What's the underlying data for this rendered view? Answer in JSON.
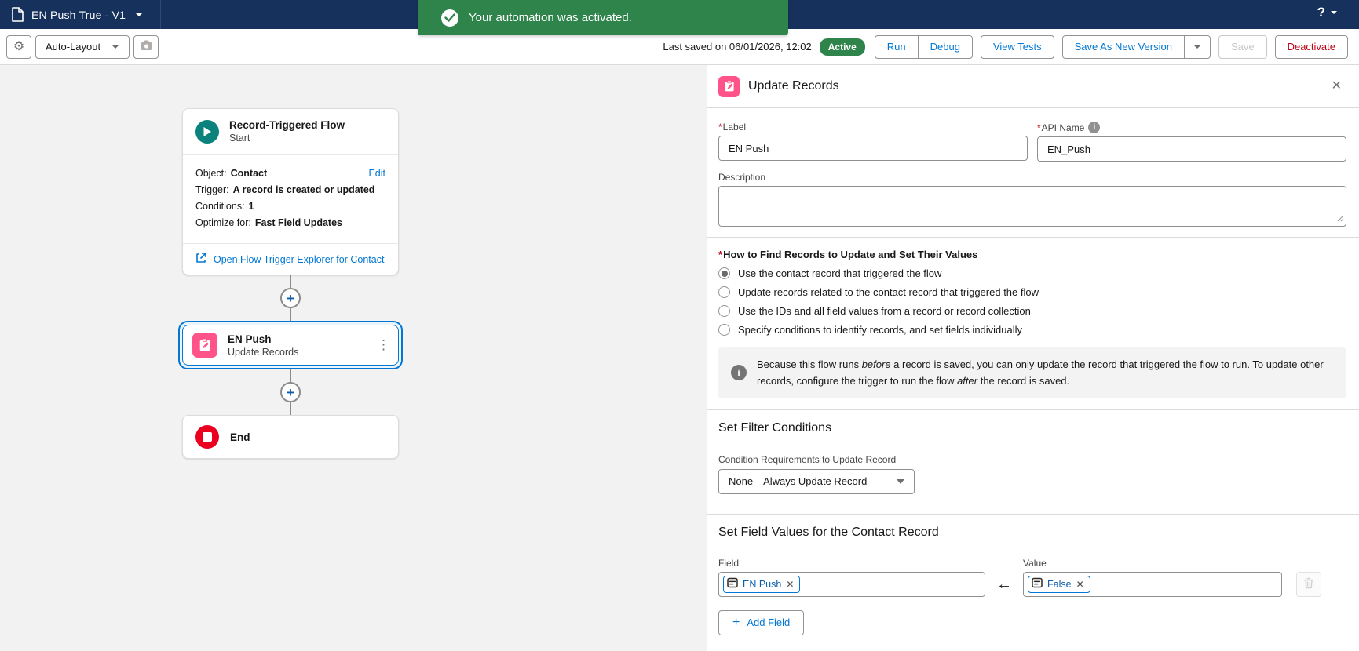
{
  "colors": {
    "header_navy": "#16325c",
    "success_green": "#2e844a",
    "brand_blue": "#0176d3",
    "update_pink": "#ff538a",
    "start_teal": "#0b827c",
    "end_red": "#ea001e",
    "danger_red": "#ba0517"
  },
  "top_bar": {
    "flow_title": "EN Push True - V1",
    "help_label": "?"
  },
  "toast": {
    "message": "Your automation was activated."
  },
  "toolbar": {
    "layout_label": "Auto-Layout",
    "last_saved": "Last saved on 06/01/2026, 12:02",
    "status": "Active",
    "run": "Run",
    "debug": "Debug",
    "view_tests": "View Tests",
    "save_as_new_version": "Save As New Version",
    "save": "Save",
    "deactivate": "Deactivate"
  },
  "canvas": {
    "start": {
      "title": "Record-Triggered Flow",
      "subtitle": "Start",
      "edit": "Edit",
      "rows": [
        {
          "label": "Object:",
          "value": "Contact"
        },
        {
          "label": "Trigger:",
          "value": "A record is created or updated"
        },
        {
          "label": "Conditions:",
          "value": "1"
        },
        {
          "label": "Optimize for:",
          "value": "Fast Field Updates"
        }
      ],
      "explorer_link": "Open Flow Trigger Explorer for Contact"
    },
    "update_node": {
      "title": "EN Push",
      "subtitle": "Update Records",
      "menu": "⋮"
    },
    "end_node": {
      "title": "End"
    }
  },
  "panel": {
    "title": "Update Records",
    "close_glyph": "✕",
    "label_field": {
      "label": "Label",
      "value": "EN Push"
    },
    "api_name_field": {
      "label": "API Name",
      "value": "EN_Push"
    },
    "description_label": "Description",
    "how_to_find": {
      "label": "How to Find Records to Update and Set Their Values",
      "options": [
        {
          "label": "Use the contact record that triggered the flow",
          "selected": true
        },
        {
          "label": "Update records related to the contact record that triggered the flow",
          "selected": false
        },
        {
          "label": "Use the IDs and all field values from a record or record collection",
          "selected": false
        },
        {
          "label": "Specify conditions to identify records, and set fields individually",
          "selected": false
        }
      ]
    },
    "info_note_segments": [
      {
        "text": "Because this flow runs "
      },
      {
        "text": "before",
        "italic": true
      },
      {
        "text": " a record is saved, you can only update the record that triggered the flow to run. To update other records, configure the trigger to run the flow "
      },
      {
        "text": "after",
        "italic": true
      },
      {
        "text": " the record is saved."
      }
    ],
    "filter": {
      "heading": "Set Filter Conditions",
      "condition_label": "Condition Requirements to Update Record",
      "condition_value": "None—Always Update Record"
    },
    "field_values": {
      "heading": "Set Field Values for the Contact Record",
      "field_label": "Field",
      "value_label": "Value",
      "field_pill": "EN Push",
      "value_pill": "False",
      "add_field": "Add Field"
    }
  }
}
